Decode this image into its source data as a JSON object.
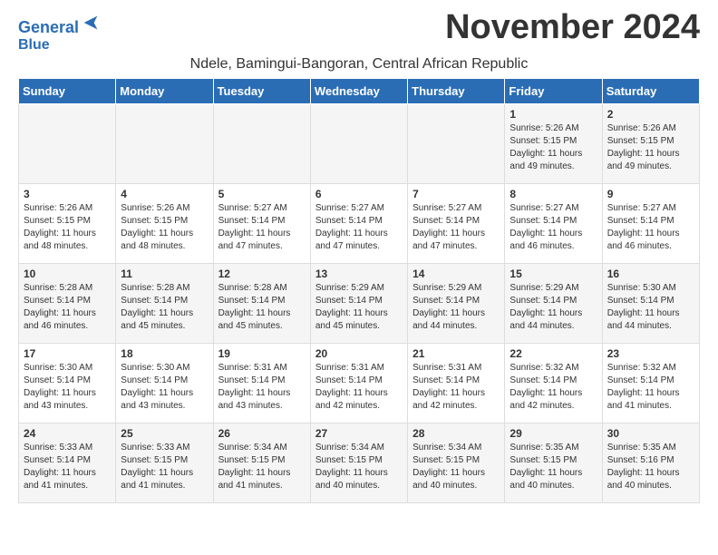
{
  "logo": {
    "line1": "General",
    "line2": "Blue",
    "arrow_color": "#2a6db5"
  },
  "title": "November 2024",
  "subtitle": "Ndele, Bamingui-Bangoran, Central African Republic",
  "days_of_week": [
    "Sunday",
    "Monday",
    "Tuesday",
    "Wednesday",
    "Thursday",
    "Friday",
    "Saturday"
  ],
  "weeks": [
    [
      {
        "day": "",
        "info": ""
      },
      {
        "day": "",
        "info": ""
      },
      {
        "day": "",
        "info": ""
      },
      {
        "day": "",
        "info": ""
      },
      {
        "day": "",
        "info": ""
      },
      {
        "day": "1",
        "info": "Sunrise: 5:26 AM\nSunset: 5:15 PM\nDaylight: 11 hours and 49 minutes."
      },
      {
        "day": "2",
        "info": "Sunrise: 5:26 AM\nSunset: 5:15 PM\nDaylight: 11 hours and 49 minutes."
      }
    ],
    [
      {
        "day": "3",
        "info": "Sunrise: 5:26 AM\nSunset: 5:15 PM\nDaylight: 11 hours and 48 minutes."
      },
      {
        "day": "4",
        "info": "Sunrise: 5:26 AM\nSunset: 5:15 PM\nDaylight: 11 hours and 48 minutes."
      },
      {
        "day": "5",
        "info": "Sunrise: 5:27 AM\nSunset: 5:14 PM\nDaylight: 11 hours and 47 minutes."
      },
      {
        "day": "6",
        "info": "Sunrise: 5:27 AM\nSunset: 5:14 PM\nDaylight: 11 hours and 47 minutes."
      },
      {
        "day": "7",
        "info": "Sunrise: 5:27 AM\nSunset: 5:14 PM\nDaylight: 11 hours and 47 minutes."
      },
      {
        "day": "8",
        "info": "Sunrise: 5:27 AM\nSunset: 5:14 PM\nDaylight: 11 hours and 46 minutes."
      },
      {
        "day": "9",
        "info": "Sunrise: 5:27 AM\nSunset: 5:14 PM\nDaylight: 11 hours and 46 minutes."
      }
    ],
    [
      {
        "day": "10",
        "info": "Sunrise: 5:28 AM\nSunset: 5:14 PM\nDaylight: 11 hours and 46 minutes."
      },
      {
        "day": "11",
        "info": "Sunrise: 5:28 AM\nSunset: 5:14 PM\nDaylight: 11 hours and 45 minutes."
      },
      {
        "day": "12",
        "info": "Sunrise: 5:28 AM\nSunset: 5:14 PM\nDaylight: 11 hours and 45 minutes."
      },
      {
        "day": "13",
        "info": "Sunrise: 5:29 AM\nSunset: 5:14 PM\nDaylight: 11 hours and 45 minutes."
      },
      {
        "day": "14",
        "info": "Sunrise: 5:29 AM\nSunset: 5:14 PM\nDaylight: 11 hours and 44 minutes."
      },
      {
        "day": "15",
        "info": "Sunrise: 5:29 AM\nSunset: 5:14 PM\nDaylight: 11 hours and 44 minutes."
      },
      {
        "day": "16",
        "info": "Sunrise: 5:30 AM\nSunset: 5:14 PM\nDaylight: 11 hours and 44 minutes."
      }
    ],
    [
      {
        "day": "17",
        "info": "Sunrise: 5:30 AM\nSunset: 5:14 PM\nDaylight: 11 hours and 43 minutes."
      },
      {
        "day": "18",
        "info": "Sunrise: 5:30 AM\nSunset: 5:14 PM\nDaylight: 11 hours and 43 minutes."
      },
      {
        "day": "19",
        "info": "Sunrise: 5:31 AM\nSunset: 5:14 PM\nDaylight: 11 hours and 43 minutes."
      },
      {
        "day": "20",
        "info": "Sunrise: 5:31 AM\nSunset: 5:14 PM\nDaylight: 11 hours and 42 minutes."
      },
      {
        "day": "21",
        "info": "Sunrise: 5:31 AM\nSunset: 5:14 PM\nDaylight: 11 hours and 42 minutes."
      },
      {
        "day": "22",
        "info": "Sunrise: 5:32 AM\nSunset: 5:14 PM\nDaylight: 11 hours and 42 minutes."
      },
      {
        "day": "23",
        "info": "Sunrise: 5:32 AM\nSunset: 5:14 PM\nDaylight: 11 hours and 41 minutes."
      }
    ],
    [
      {
        "day": "24",
        "info": "Sunrise: 5:33 AM\nSunset: 5:14 PM\nDaylight: 11 hours and 41 minutes."
      },
      {
        "day": "25",
        "info": "Sunrise: 5:33 AM\nSunset: 5:15 PM\nDaylight: 11 hours and 41 minutes."
      },
      {
        "day": "26",
        "info": "Sunrise: 5:34 AM\nSunset: 5:15 PM\nDaylight: 11 hours and 41 minutes."
      },
      {
        "day": "27",
        "info": "Sunrise: 5:34 AM\nSunset: 5:15 PM\nDaylight: 11 hours and 40 minutes."
      },
      {
        "day": "28",
        "info": "Sunrise: 5:34 AM\nSunset: 5:15 PM\nDaylight: 11 hours and 40 minutes."
      },
      {
        "day": "29",
        "info": "Sunrise: 5:35 AM\nSunset: 5:15 PM\nDaylight: 11 hours and 40 minutes."
      },
      {
        "day": "30",
        "info": "Sunrise: 5:35 AM\nSunset: 5:16 PM\nDaylight: 11 hours and 40 minutes."
      }
    ]
  ]
}
